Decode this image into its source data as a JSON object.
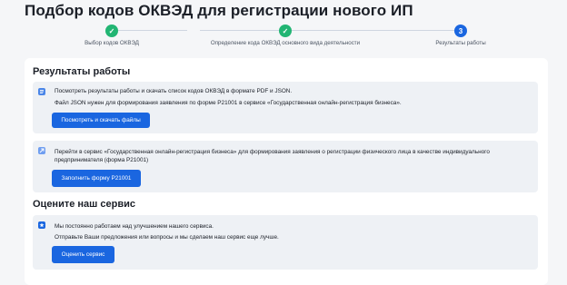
{
  "page": {
    "title": "Подбор кодов ОКВЭД для регистрации нового ИП"
  },
  "stepper": {
    "steps": [
      {
        "label": "Выбор кодов ОКВЭД",
        "status": "done",
        "marker": "✓"
      },
      {
        "label": "Определение кода ОКВЭД основного вида деятельности",
        "status": "done",
        "marker": "✓"
      },
      {
        "label": "Результаты работы",
        "status": "active",
        "marker": "3"
      }
    ]
  },
  "results": {
    "title": "Результаты работы",
    "download_box": {
      "icon": "document-icon",
      "line1": "Посмотреть результаты работы и скачать список кодов ОКВЭД в формате PDF и JSON.",
      "line2": "Файл JSON нужен для формирования заявления по форме Р21001 в сервисе «Государственная онлайн-регистрация бизнеса».",
      "button": "Посмотреть и скачать файлы"
    },
    "form_box": {
      "icon": "arrow-icon",
      "line1": "Перейти в сервис «Государственная онлайн-регистрация бизнеса» для формирования заявления о регистрации физического лица в качестве индивидуального",
      "line2": "предпринимателя (форма Р21001)",
      "button": "Заполнить форму Р21001"
    }
  },
  "feedback": {
    "title": "Оцените наш сервис",
    "box": {
      "icon": "star-icon",
      "line1": "Мы постоянно работаем над улучшением нашего сервиса.",
      "line2": "Отправьте Ваши предложения или вопросы и мы сделаем наш сервис еще лучше.",
      "button": "Оценить сервис"
    }
  },
  "colors": {
    "accent": "#1a66e0",
    "done": "#22b573",
    "box_bg": "#eef1f5"
  }
}
